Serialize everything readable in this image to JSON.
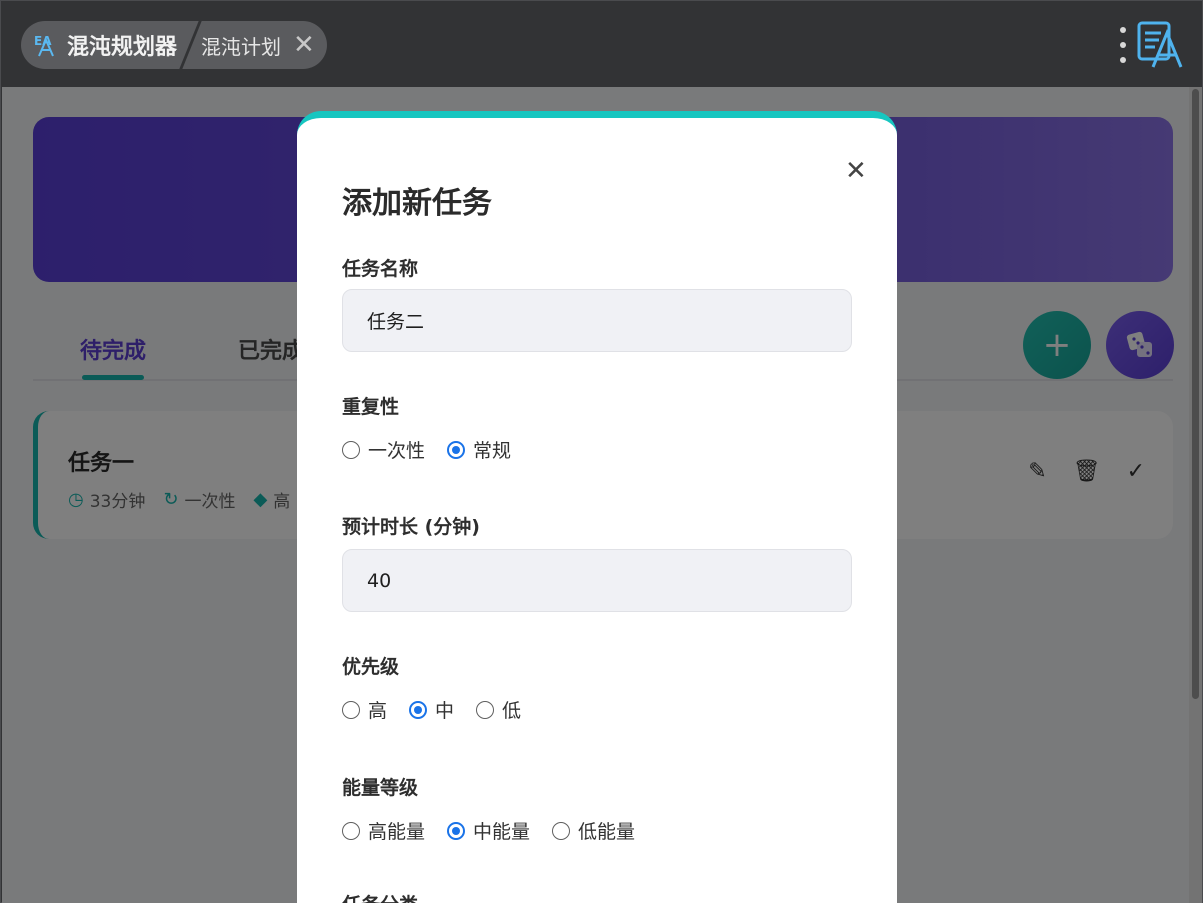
{
  "header": {
    "app_name": "混沌规划器",
    "tab_label": "混沌计划"
  },
  "tabs": {
    "pending": "待完成",
    "done": "已完成"
  },
  "task_card": {
    "title": "任务一",
    "duration": "33分钟",
    "repeat": "一次性",
    "tag": "高"
  },
  "modal": {
    "title": "添加新任务",
    "name_label": "任务名称",
    "name_value": "任务二",
    "repeat_label": "重复性",
    "repeat_options": [
      "一次性",
      "常规"
    ],
    "repeat_selected": "常规",
    "duration_label": "预计时长 (分钟)",
    "duration_value": "40",
    "priority_label": "优先级",
    "priority_options": [
      "高",
      "中",
      "低"
    ],
    "priority_selected": "中",
    "energy_label": "能量等级",
    "energy_options": [
      "高能量",
      "中能量",
      "低能量"
    ],
    "energy_selected": "中能量",
    "category_label": "任务分类"
  },
  "colors": {
    "accent_teal": "#17b6ae",
    "accent_purple": "#5c3fd2",
    "radio_blue": "#1a73e8"
  },
  "icons": {
    "app": "app-logo-icon",
    "close": "close-icon",
    "add": "plus-icon",
    "random": "dice-icon",
    "clock": "clock-icon",
    "repeat": "repeat-icon",
    "tag": "tag-icon",
    "edit": "edit-icon",
    "delete": "trash-icon",
    "complete": "check-icon"
  }
}
